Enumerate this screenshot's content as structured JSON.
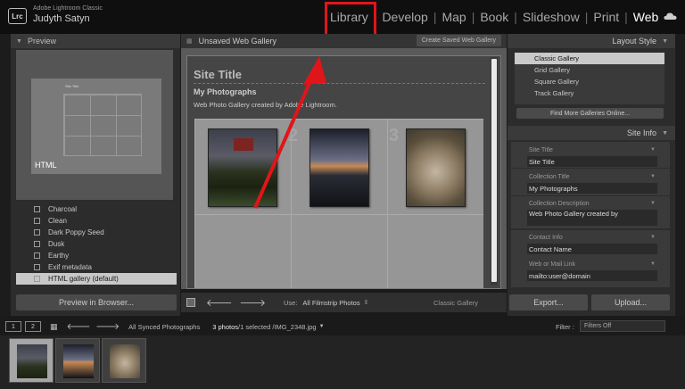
{
  "app": {
    "logo": "Lrc",
    "name": "Adobe Lightroom Classic",
    "user": "Judyth Satyn"
  },
  "modules": [
    {
      "label": "Library",
      "active": false
    },
    {
      "label": "Develop",
      "active": false
    },
    {
      "label": "Map",
      "active": false
    },
    {
      "label": "Book",
      "active": false
    },
    {
      "label": "Slideshow",
      "active": false
    },
    {
      "label": "Print",
      "active": false
    },
    {
      "label": "Web",
      "active": true
    }
  ],
  "left_panel": {
    "preview_title": "Preview",
    "preview_tag": "HTML",
    "preview_site_text": "Site Title",
    "templates": [
      {
        "label": "Charcoal",
        "selected": false
      },
      {
        "label": "Clean",
        "selected": false
      },
      {
        "label": "Dark Poppy Seed",
        "selected": false
      },
      {
        "label": "Dusk",
        "selected": false
      },
      {
        "label": "Earthy",
        "selected": false
      },
      {
        "label": "Exif metadata",
        "selected": false
      },
      {
        "label": "HTML gallery (default)",
        "selected": true
      }
    ],
    "preview_button": "Preview in Browser..."
  },
  "center": {
    "gallery_name": "Unsaved Web Gallery",
    "create_saved": "Create Saved Web Gallery",
    "site_title": "Site Title",
    "collection_title": "My Photographs",
    "collection_description": "Web Photo Gallery created by Adobe Lightroom.",
    "cell_numbers": [
      "1",
      "2",
      "3"
    ],
    "toolbar": {
      "use_label": "Use:",
      "use_value": "All Filmstrip Photos",
      "layout_name": "Classic Gallery"
    }
  },
  "right_panel": {
    "layout_style_title": "Layout Style",
    "layouts": [
      {
        "label": "Classic Gallery",
        "selected": true
      },
      {
        "label": "Grid Gallery",
        "selected": false
      },
      {
        "label": "Square Gallery",
        "selected": false
      },
      {
        "label": "Track Gallery",
        "selected": false
      }
    ],
    "find_more": "Find More Galleries Online...",
    "site_info_title": "Site Info",
    "site_info": [
      {
        "label": "Site Title",
        "value": "Site Title"
      },
      {
        "label": "Collection Title",
        "value": "My Photographs"
      },
      {
        "label": "Collection Description",
        "value": "Web Photo Gallery created by"
      },
      {
        "label": "Contact Info",
        "value": "Contact Name"
      },
      {
        "label": "Web or Mail Link",
        "value": "mailto:user@domain"
      }
    ],
    "export_button": "Export...",
    "upload_button": "Upload..."
  },
  "filmbar": {
    "view1": "1",
    "view2": "2",
    "source": "All Synced Photographs",
    "count": "3 photos",
    "selection": " /1 selected /IMG_2348.jpg",
    "filter_label": "Filter :",
    "filter_value": "Filters Off"
  },
  "colors": {
    "annotation_red": "#e0151a",
    "active_module": "#ffffff"
  }
}
